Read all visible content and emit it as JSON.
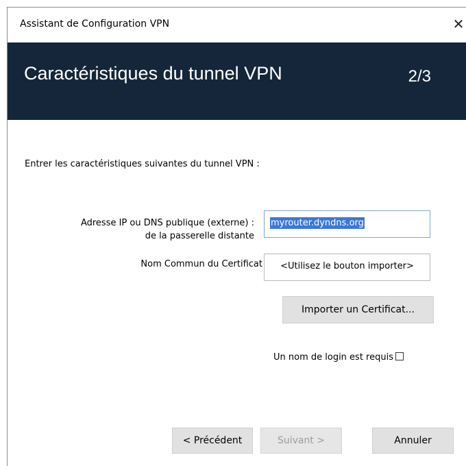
{
  "window": {
    "title": "Assistant de Configuration VPN",
    "close_glyph": "✕"
  },
  "banner": {
    "heading": "Caractéristiques du tunnel VPN",
    "step": "2/3",
    "background_color": "#15263a"
  },
  "form": {
    "intro": "Entrer les caractéristiques suivantes du tunnel VPN :",
    "gateway_label_line1": "Adresse IP ou DNS publique (externe) :",
    "gateway_label_line2": "de la passerelle distante",
    "gateway_value": "myrouter.dyndns.org",
    "cert_label": "Nom Commun du Certificat",
    "cert_value": "<Utilisez le bouton importer>",
    "import_button": "Importer un Certificat...",
    "login_label": "Un nom de login est requis",
    "login_checked": false
  },
  "footer": {
    "prev_button": "< Précédent",
    "next_button": "Suivant >",
    "next_enabled": false,
    "cancel_button": "Annuler"
  }
}
